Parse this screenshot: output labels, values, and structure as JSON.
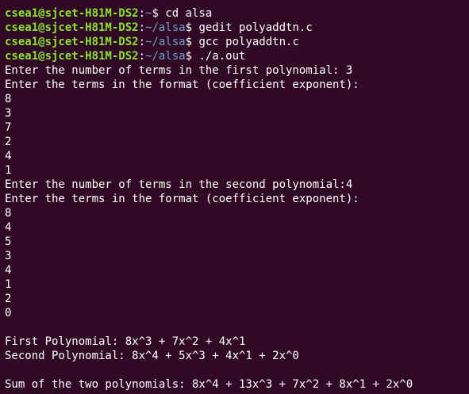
{
  "terminal": {
    "colors": {
      "background": "#300a24",
      "text": "#ffffff",
      "user_host": "#8ae234",
      "path": "#729fcf"
    },
    "prompts": [
      {
        "user_host": "csea1@sjcet-H81M-DS2",
        "path": "~",
        "command": "cd alsa"
      },
      {
        "user_host": "csea1@sjcet-H81M-DS2",
        "path": "~/alsa",
        "command": "gedit polyaddtn.c"
      },
      {
        "user_host": "csea1@sjcet-H81M-DS2",
        "path": "~/alsa",
        "command": "gcc polyaddtn.c"
      },
      {
        "user_host": "csea1@sjcet-H81M-DS2",
        "path": "~/alsa",
        "command": "./a.out"
      }
    ],
    "output": [
      "Enter the number of terms in the first polynomial: 3",
      "Enter the terms in the format (coefficient exponent):",
      "8",
      "3",
      "7",
      "2",
      "4",
      "1",
      "Enter the number of terms in the second polynomial:4",
      "Enter the terms in the format (coefficient exponent):",
      "8",
      "4",
      "5",
      "3",
      "4",
      "1",
      "2",
      "0",
      "",
      "First Polynomial: 8x^3 + 7x^2 + 4x^1",
      "Second Polynomial: 8x^4 + 5x^3 + 4x^1 + 2x^0",
      "",
      "Sum of the two polynomials: 8x^4 + 13x^3 + 7x^2 + 8x^1 + 2x^0"
    ]
  }
}
